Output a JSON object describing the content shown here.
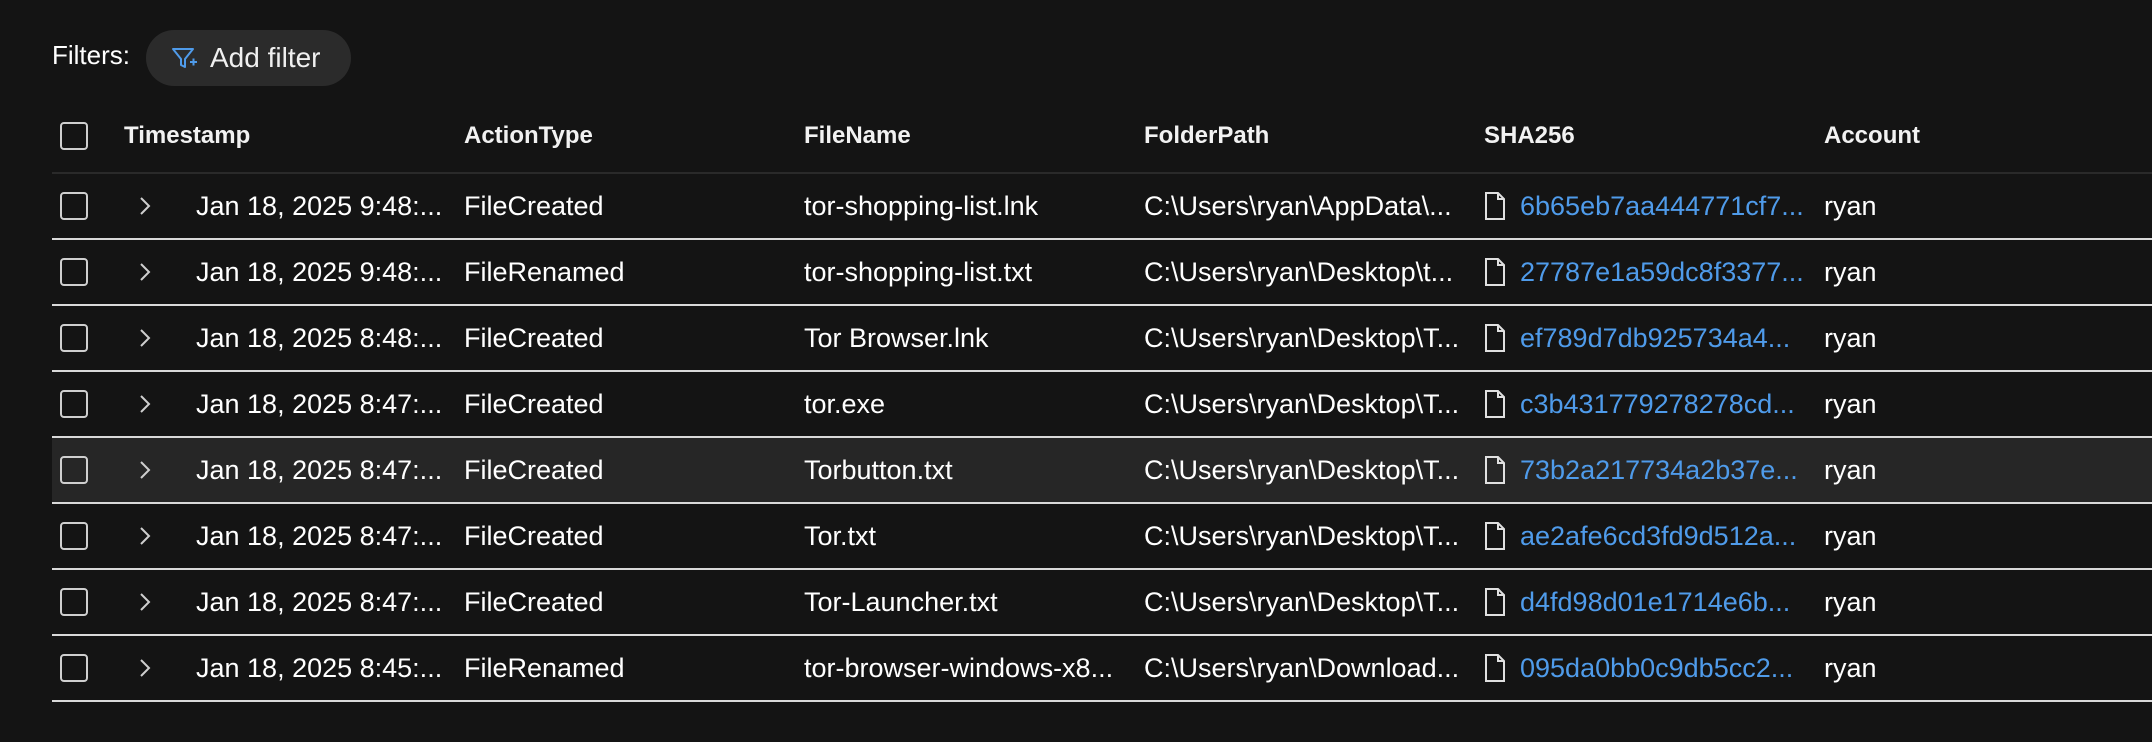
{
  "filters": {
    "label": "Filters:",
    "add_filter_label": "Add filter",
    "add_filter_icon": "filter-add-icon"
  },
  "table": {
    "columns": {
      "timestamp": "Timestamp",
      "action_type": "ActionType",
      "file_name": "FileName",
      "folder_path": "FolderPath",
      "sha256": "SHA256",
      "account": "Account"
    },
    "rows": [
      {
        "timestamp": "Jan 18, 2025 9:48:...",
        "action_type": "FileCreated",
        "file_name": "tor-shopping-list.lnk",
        "folder_path": "C:\\Users\\ryan\\AppData\\...",
        "sha256": "6b65eb7aa444771cf7...",
        "account": "ryan"
      },
      {
        "timestamp": "Jan 18, 2025 9:48:...",
        "action_type": "FileRenamed",
        "file_name": "tor-shopping-list.txt",
        "folder_path": "C:\\Users\\ryan\\Desktop\\t...",
        "sha256": "27787e1a59dc8f3377...",
        "account": "ryan"
      },
      {
        "timestamp": "Jan 18, 2025 8:48:...",
        "action_type": "FileCreated",
        "file_name": "Tor Browser.lnk",
        "folder_path": "C:\\Users\\ryan\\Desktop\\T...",
        "sha256": "ef789d7db925734a4...",
        "account": "ryan"
      },
      {
        "timestamp": "Jan 18, 2025 8:47:...",
        "action_type": "FileCreated",
        "file_name": "tor.exe",
        "folder_path": "C:\\Users\\ryan\\Desktop\\T...",
        "sha256": "c3b431779278278cd...",
        "account": "ryan"
      },
      {
        "timestamp": "Jan 18, 2025 8:47:...",
        "action_type": "FileCreated",
        "file_name": "Torbutton.txt",
        "folder_path": "C:\\Users\\ryan\\Desktop\\T...",
        "sha256": "73b2a217734a2b37e...",
        "account": "ryan"
      },
      {
        "timestamp": "Jan 18, 2025 8:47:...",
        "action_type": "FileCreated",
        "file_name": "Tor.txt",
        "folder_path": "C:\\Users\\ryan\\Desktop\\T...",
        "sha256": "ae2afe6cd3fd9d512a...",
        "account": "ryan"
      },
      {
        "timestamp": "Jan 18, 2025 8:47:...",
        "action_type": "FileCreated",
        "file_name": "Tor-Launcher.txt",
        "folder_path": "C:\\Users\\ryan\\Desktop\\T...",
        "sha256": "d4fd98d01e1714e6b...",
        "account": "ryan"
      },
      {
        "timestamp": "Jan 18, 2025 8:45:...",
        "action_type": "FileRenamed",
        "file_name": "tor-browser-windows-x8...",
        "folder_path": "C:\\Users\\ryan\\Download...",
        "sha256": "095da0bb0c9db5cc2...",
        "account": "ryan"
      }
    ]
  },
  "colors": {
    "background": "#141414",
    "link": "#4f9bea",
    "highlight_row": "#262626",
    "filter_icon": "#4f9bea"
  }
}
